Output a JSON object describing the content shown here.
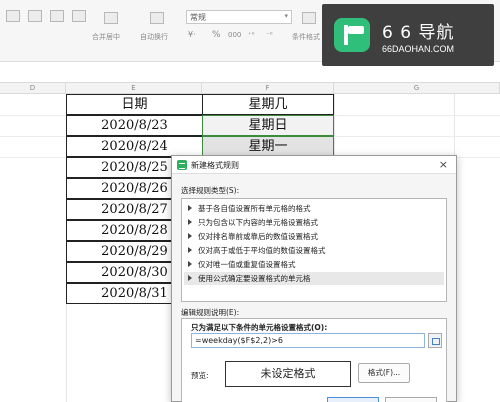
{
  "ribbon": {
    "number_format": "常规",
    "merge_center_label": "合并居中",
    "auto_wrap_label": "自动换行",
    "cond_format_label": "条件格式",
    "percent_symbol": "%",
    "thousands_symbol": "000"
  },
  "logo": {
    "title": "6 6 导航",
    "subtitle": "66DAOHAN.COM"
  },
  "sheet": {
    "columns": [
      "D",
      "E",
      "F",
      "G"
    ],
    "header_date": "日期",
    "header_weekday": "星期几",
    "dates": [
      "2020/8/23",
      "2020/8/24",
      "2020/8/25",
      "2020/8/26",
      "2020/8/27",
      "2020/8/28",
      "2020/8/29",
      "2020/8/30",
      "2020/8/31"
    ],
    "weekdays": [
      "星期日",
      "星期一"
    ]
  },
  "dialog": {
    "title": "新建格式规则",
    "close_symbol": "×",
    "select_rule_type_label": "选择规则类型(S):",
    "rule_types": [
      "基于各自值设置所有单元格的格式",
      "只为包含以下内容的单元格设置格式",
      "仅对排名靠前或靠后的数值设置格式",
      "仅对高于或低于平均值的数值设置格式",
      "仅对唯一值或重复值设置格式",
      "使用公式确定要设置格式的单元格"
    ],
    "edit_rule_label": "编辑规则说明(E):",
    "formula_heading": "只为满足以下条件的单元格设置格式(O):",
    "formula_value": "=weekday($F$2,2)>6",
    "preview_label": "预览:",
    "preview_text": "未设定格式",
    "format_button": "格式(F)..."
  }
}
